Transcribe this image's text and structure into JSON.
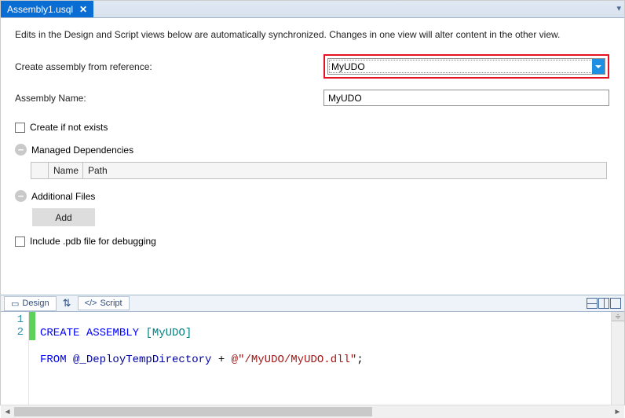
{
  "tab": {
    "title": "Assembly1.usql",
    "close": "✕",
    "overflow": "▾"
  },
  "info": "Edits in the Design and Script views below are automatically synchronized. Changes in one view will alter content in the other view.",
  "form": {
    "referenceLabel": "Create assembly from reference:",
    "referenceValue": "MyUDO",
    "nameLabel": "Assembly Name:",
    "nameValue": "MyUDO",
    "createIfNotExists": "Create if not exists",
    "managedDeps": "Managed Dependencies",
    "depsCols": {
      "name": "Name",
      "path": "Path"
    },
    "additionalFiles": "Additional Files",
    "addBtn": "Add",
    "includePdb": "Include .pdb file for debugging"
  },
  "bottomTabs": {
    "design": "Design",
    "script": "Script",
    "swap": "⇅"
  },
  "code": {
    "line1_kw1": "CREATE",
    "line1_kw2": "ASSEMBLY",
    "line1_id": " [MyUDO]",
    "line2_kw": "FROM",
    "line2_at": " @_DeployTempDirectory",
    "line2_plus": " + ",
    "line2_str": "@\"/MyUDO/MyUDO.dll\"",
    "line2_semi": ";",
    "ln1": "1",
    "ln2": "2"
  }
}
